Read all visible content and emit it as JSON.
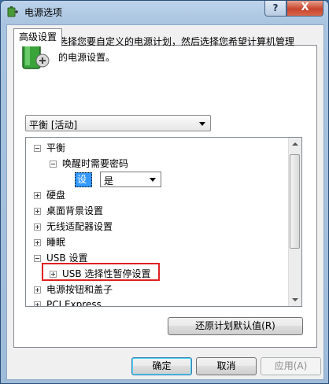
{
  "window": {
    "title": "电源选项",
    "help_symbol": "?",
    "close_symbol": "X"
  },
  "tab": {
    "label": "高级设置"
  },
  "description": "选择您要自定义的电源计划，然后选择您希望计算机管理的电源设置。",
  "plan_select": {
    "value": "平衡 [活动]"
  },
  "tree": {
    "items": [
      {
        "label": "平衡",
        "expanded": true
      },
      {
        "label": "唤醒时需要密码",
        "expanded": true
      },
      {
        "label": "硬盘",
        "expanded": false
      },
      {
        "label": "桌面背景设置",
        "expanded": false
      },
      {
        "label": "无线适配器设置",
        "expanded": false
      },
      {
        "label": "睡眠",
        "expanded": false
      },
      {
        "label": "USB 设置",
        "expanded": true
      },
      {
        "label": "USB 选择性暂停设置",
        "expanded": false
      },
      {
        "label": "电源按钮和盖子",
        "expanded": false
      },
      {
        "label": "PCI Express",
        "expanded": false
      }
    ],
    "setting": {
      "label": "设置:",
      "value": "是"
    }
  },
  "buttons": {
    "restore": "还原计划默认值(R)",
    "ok": "确定",
    "cancel": "取消",
    "apply": "应用(A)"
  },
  "colors": {
    "selection": "#3399ff",
    "highlight_box": "#e02020",
    "title_bar": "#a9c4e0"
  }
}
